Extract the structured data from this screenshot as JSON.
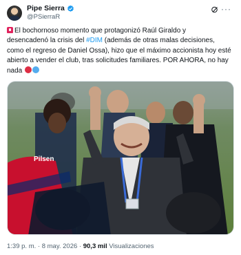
{
  "author": {
    "name": "Pipe Sierra",
    "handle": "@PSierraR"
  },
  "post": {
    "line1": "El bochornoso momento que protagonizó Raúl Giraldo y",
    "line2_pre": "desencadenó la crisis del ",
    "hashtag": "#DIM",
    "line2_post": " (además de otras malas decisiones,",
    "line3": "como el regreso de Daniel Ossa), hizo que el máximo accionista hoy esté",
    "line4": "abierto a vender el club, tras solicitudes familiares. POR AHORA, no hay",
    "line5": "nada"
  },
  "media": {
    "jersey_text": "Pilsen",
    "colors": {
      "red": "#c8102e",
      "blue": "#0a2a6b",
      "pitch": "#6d9b3a"
    }
  },
  "meta": {
    "time": "1:39 p. m.",
    "separator": "·",
    "date": "8 may. 2026",
    "views": "90,3 mil",
    "views_label": "Visualizaciones"
  },
  "icons": [
    "verified-badge-icon",
    "grok-icon",
    "more-icon",
    "siren-icon"
  ]
}
